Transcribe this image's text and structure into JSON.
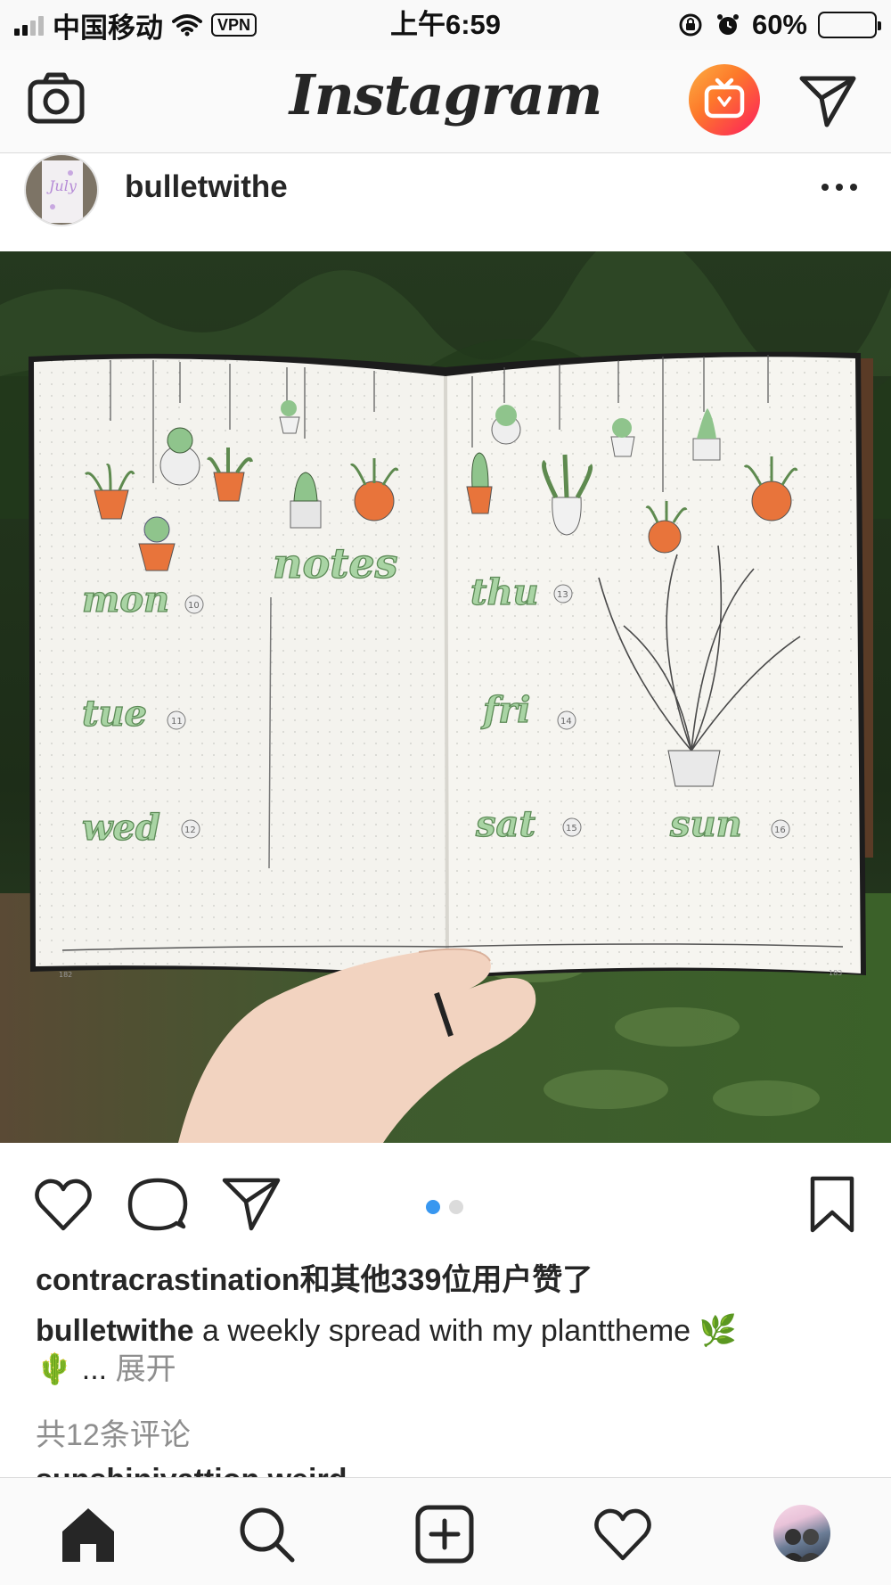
{
  "status_bar": {
    "carrier": "中国移动",
    "vpn_label": "VPN",
    "time": "上午6:59",
    "battery_percent": "60%",
    "battery_level": 0.6
  },
  "nav": {
    "logo_text": "Instagram",
    "icons": [
      "camera-icon",
      "igtv-icon",
      "direct-message-icon"
    ]
  },
  "post": {
    "username": "bulletwithe",
    "more_icon": "more-horizontal-icon",
    "photo_pages": 2,
    "photo_current_page": 1,
    "journal": {
      "days": [
        "mon",
        "tue",
        "wed",
        "thu",
        "fri",
        "sat",
        "sun"
      ],
      "day_numbers": [
        "10",
        "11",
        "12",
        "13",
        "14",
        "15",
        "16"
      ],
      "notes_heading": "notes",
      "page_numbers": [
        "182",
        "183"
      ]
    },
    "likes_text": "contracrastination和其他339位用户赞了",
    "caption": {
      "username": "bulletwithe",
      "text": "a weekly spread with my planttheme 🌿",
      "text2": "🌵 ...",
      "expand_label": "展开"
    },
    "comments_label": "共12条评论",
    "partial_comment": "sunshinivattion weird...."
  },
  "tabbar": {
    "icons": [
      "home-icon",
      "search-icon",
      "new-post-icon",
      "activity-heart-icon",
      "profile-avatar"
    ]
  },
  "colors": {
    "accent_blue": "#3897f0",
    "text": "#262626",
    "muted": "#8e8e8e",
    "leaf_green": "#8fc48c",
    "pot_orange": "#e8743b"
  }
}
